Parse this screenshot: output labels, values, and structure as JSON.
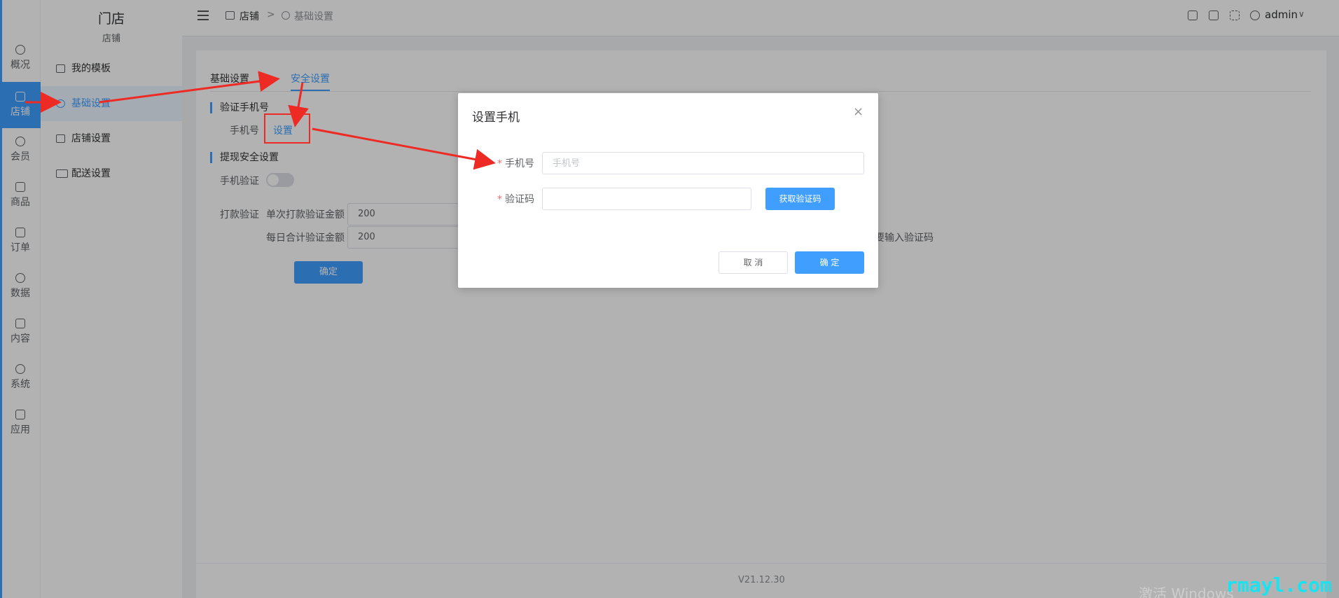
{
  "left_nav": {
    "items": [
      {
        "label": "概况",
        "icon": "dashboard-icon"
      },
      {
        "label": "店铺",
        "icon": "store-icon",
        "active": true
      },
      {
        "label": "会员",
        "icon": "user-icon"
      },
      {
        "label": "商品",
        "icon": "box-icon"
      },
      {
        "label": "订单",
        "icon": "clipboard-icon"
      },
      {
        "label": "数据",
        "icon": "pie-icon"
      },
      {
        "label": "内容",
        "icon": "folder-icon"
      },
      {
        "label": "系统",
        "icon": "gear-icon"
      },
      {
        "label": "应用",
        "icon": "cube-icon"
      }
    ]
  },
  "sub_nav": {
    "title": "门店",
    "subtitle": "店铺",
    "items": [
      {
        "label": "我的模板",
        "icon": "template-icon"
      },
      {
        "label": "基础设置",
        "icon": "gear-icon",
        "active": true
      },
      {
        "label": "店铺设置",
        "icon": "store-icon"
      },
      {
        "label": "配送设置",
        "icon": "truck-icon"
      }
    ]
  },
  "header": {
    "breadcrumb_home": "店铺",
    "breadcrumb_sep": ">",
    "breadcrumb_current": "基础设置",
    "user": "admin",
    "user_caret": "∨"
  },
  "main": {
    "tabs": [
      {
        "label": "基础设置"
      },
      {
        "label": "安全设置",
        "active": true
      }
    ],
    "verify_phone_section": "验证手机号",
    "phone_label": "手机号",
    "phone_set_link": "设置",
    "withdraw_section": "提现安全设置",
    "phone_verify_label": "手机验证",
    "payment_verify_label": "打款验证",
    "single_amount_label": "单次打款验证金额",
    "single_amount_value": "200",
    "daily_amount_label": "每日合计验证金额",
    "daily_amount_value": "200",
    "verify_hint": "要输入验证码",
    "confirm_label": "确定",
    "version": "V21.12.30"
  },
  "dialog": {
    "title": "设置手机",
    "close_glyph": "×",
    "required_mark": "*",
    "phone_label": "手机号",
    "phone_placeholder": "手机号",
    "code_label": "验证码",
    "get_code_label": "获取验证码",
    "cancel_label": "取 消",
    "ok_label": "确 定"
  },
  "watermarks": {
    "windows": "激活 Windows",
    "site": "rmayl.com"
  },
  "colors": {
    "primary": "#409eff",
    "annotation": "#ee2a24",
    "watermark": "#19e3f0"
  }
}
